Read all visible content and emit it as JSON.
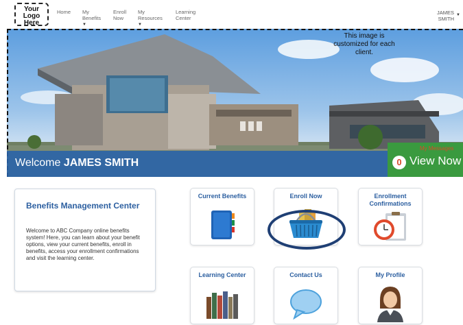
{
  "logo": {
    "lines": [
      "Your",
      "Logo",
      "Here"
    ]
  },
  "nav": {
    "items": [
      {
        "line1": "Home",
        "line2": "",
        "caret": false
      },
      {
        "line1": "My",
        "line2": "Benefits",
        "caret": true
      },
      {
        "line1": "Enroll",
        "line2": "Now",
        "caret": false
      },
      {
        "line1": "My",
        "line2": "Resources",
        "caret": true
      },
      {
        "line1": "Learning",
        "line2": "Center",
        "caret": false
      }
    ],
    "user": {
      "first": "JAMES",
      "last": "SMITH"
    }
  },
  "hero": {
    "note": "This image is customized for each client.",
    "welcome_prefix": "Welcome",
    "welcome_name": "JAMES SMITH",
    "messages_label": "My Messages",
    "messages_count": "0",
    "messages_link": "View Now"
  },
  "info": {
    "title": "Benefits Management Center",
    "body": "Welcome to ABC Company online benefits system! Here, you can learn about your benefit options, view your current benefits, enroll in benefits, access your enrollment confirmations and visit the learning center."
  },
  "tiles": {
    "current": "Current Benefits",
    "enroll": "Enroll Now",
    "confirm_line1": "Enrollment",
    "confirm_line2": "Confirmations",
    "learning": "Learning Center",
    "contact": "Contact Us",
    "profile": "My Profile"
  },
  "colors": {
    "accent": "#2c5fa0",
    "welcome_bar": "#2862aa",
    "messages_bg": "#3a9a3f",
    "highlight_ring": "#1f3f74"
  }
}
